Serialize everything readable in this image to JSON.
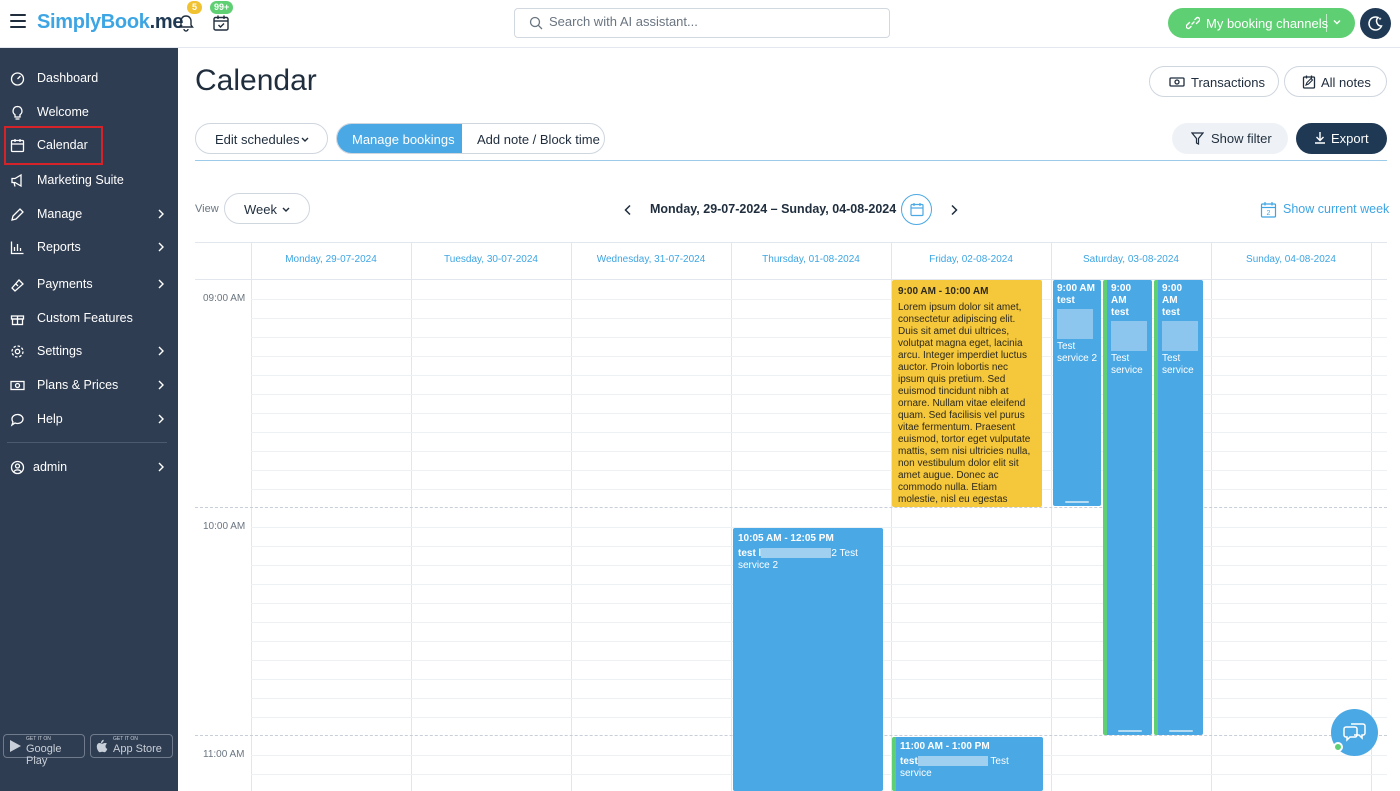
{
  "header": {
    "logo_s": "S",
    "logo_rest": "implyBook",
    "logo_tld": ".me",
    "notifications_count": "5",
    "bookings_count": "99+",
    "search_placeholder": "Search with AI assistant...",
    "booking_channels_label": "My booking channels"
  },
  "sidebar": {
    "items": [
      {
        "label": "Dashboard",
        "icon": "dashboard-icon"
      },
      {
        "label": "Welcome",
        "icon": "lightbulb-icon"
      },
      {
        "label": "Calendar",
        "icon": "calendar-icon"
      },
      {
        "label": "Marketing Suite",
        "icon": "megaphone-icon"
      },
      {
        "label": "Manage",
        "icon": "pencil-icon"
      },
      {
        "label": "Reports",
        "icon": "chart-icon"
      },
      {
        "label": "Payments",
        "icon": "payments-icon"
      },
      {
        "label": "Custom Features",
        "icon": "gift-icon"
      },
      {
        "label": "Settings",
        "icon": "gear-icon"
      },
      {
        "label": "Plans & Prices",
        "icon": "money-icon"
      },
      {
        "label": "Help",
        "icon": "chat-bubble-icon"
      }
    ],
    "user_label": "admin",
    "google_play_small": "GET IT ON",
    "google_play": "Google Play",
    "app_store_small": "GET IT ON",
    "app_store": "App Store"
  },
  "main": {
    "title": "Calendar",
    "transactions_label": "Transactions",
    "all_notes_label": "All notes",
    "edit_schedules_label": "Edit schedules",
    "manage_bookings_label": "Manage bookings",
    "add_note_label": "Add note / Block time",
    "show_filter_label": "Show filter",
    "export_label": "Export",
    "view_label": "View",
    "view_value": "Week",
    "date_range": "Monday, 29-07-2024 – Sunday, 04-08-2024",
    "show_current_week_label": "Show current week",
    "show_current_week_day": "2"
  },
  "calendar": {
    "days": [
      "Monday, 29-07-2024",
      "Tuesday, 30-07-2024",
      "Wednesday, 31-07-2024",
      "Thursday, 01-08-2024",
      "Friday, 02-08-2024",
      "Saturday, 03-08-2024",
      "Sunday, 04-08-2024"
    ],
    "times": [
      "09:00 AM",
      "10:00 AM",
      "11:00 AM"
    ],
    "events": {
      "fri_note_time": "9:00 AM - 10:00 AM",
      "fri_note_text": "Lorem ipsum dolor sit amet, consectetur adipiscing elit. Duis sit amet dui ultrices, volutpat magna eget, lacinia arcu. Integer imperdiet luctus auctor. Proin lobortis nec ipsum quis pretium. Sed euismod tincidunt nibh at ornare. Nullam vitae eleifend quam. Sed facilisis vel purus vitae fermentum. Praesent euismod, tortor eget vulputate mattis, sem nisi ultricies nulla, non vestibulum dolor elit sit amet augue. Donec ac commodo nulla. Etiam molestie, nisl eu egestas",
      "thu_time": "10:05 AM - 12:05 PM",
      "thu_client": "test l",
      "thu_suffix": "2 Test",
      "thu_service": "service 2",
      "fri2_time": "11:00 AM - 1:00 PM",
      "fri2_client": "test",
      "fri2_suffix": "Test",
      "fri2_service": "service",
      "sat1_time": "9:00 AM",
      "sat1_client": "test",
      "sat1_service": "Test service 2",
      "sat2_time": "9:00 AM",
      "sat2_client": "test",
      "sat2_service": "Test service",
      "sat3_time": "9:00 AM",
      "sat3_client": "test",
      "sat3_service": "Test service"
    }
  },
  "colors": {
    "brand_blue": "#4aa8e4",
    "brand_green": "#5fcf73",
    "sidebar_bg": "#2f3d52",
    "note_yellow": "#f5c73a",
    "active_outline": "#d6232a"
  }
}
